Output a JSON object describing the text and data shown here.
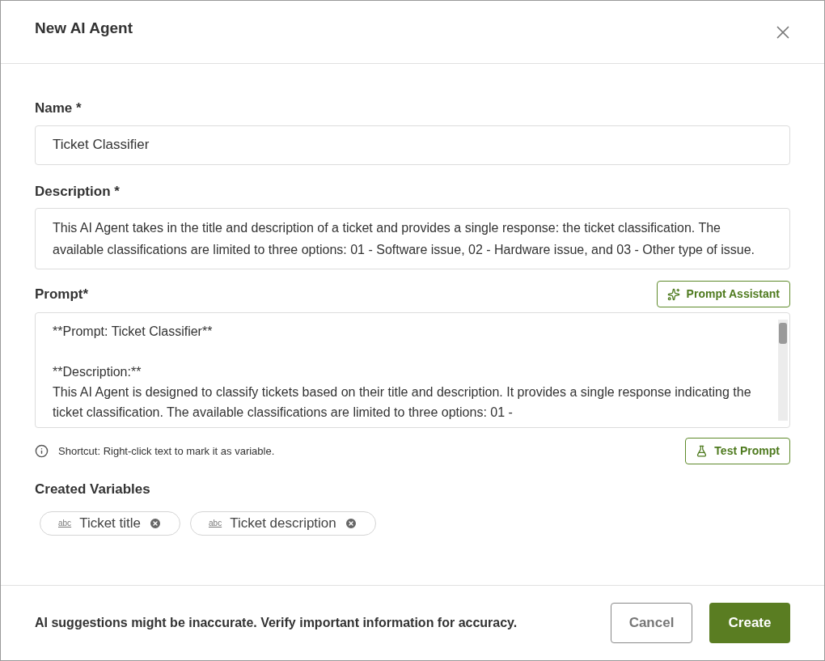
{
  "dialog": {
    "title": "New AI Agent"
  },
  "name_field": {
    "label": "Name *",
    "value": "Ticket Classifier"
  },
  "description_field": {
    "label": "Description *",
    "value": "This AI Agent takes in the title and description of a ticket and provides a single response: the ticket classification. The available classifications are limited to three options: 01 - Software issue, 02 - Hardware issue, and 03 - Other type of issue."
  },
  "prompt_field": {
    "label": "Prompt*",
    "assistant_button": "Prompt Assistant",
    "paragraphs": [
      [
        "**Prompt: Ticket Classifier**"
      ],
      [
        "**Description:**",
        "This AI Agent is designed to classify tickets based on their title and description. It provides a single response indicating the ticket classification. The available classifications are limited to three options: 01 -"
      ]
    ],
    "hint": "Shortcut: Right-click text to mark it as variable.",
    "test_button": "Test Prompt"
  },
  "variables": {
    "label": "Created Variables",
    "items": [
      {
        "type_label": "abc",
        "name": "Ticket title"
      },
      {
        "type_label": "abc",
        "name": "Ticket description"
      }
    ]
  },
  "footer": {
    "notice": "AI suggestions might be inaccurate. Verify important information for accuracy.",
    "buttons": [
      {
        "label": "Cancel",
        "kind": "secondary"
      },
      {
        "label": "Create",
        "kind": "primary"
      }
    ]
  }
}
